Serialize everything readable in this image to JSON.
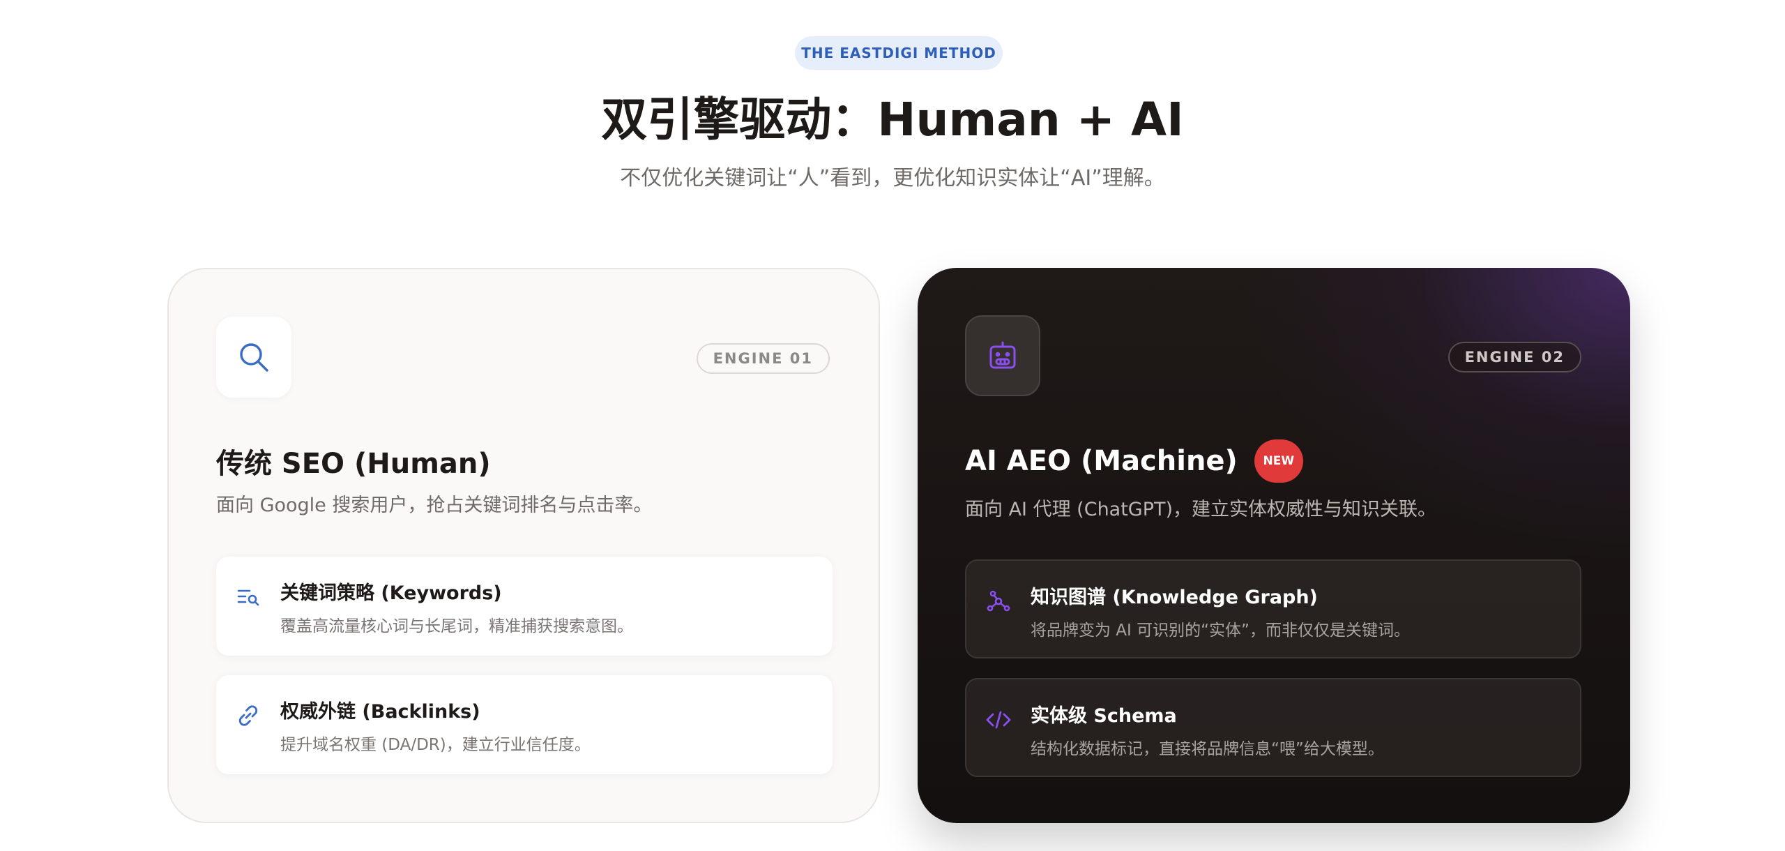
{
  "header": {
    "eyebrow": "THE EASTDIGI METHOD",
    "title": "双引擎驱动：Human + AI",
    "subtitle": "不仅优化关键词让“人”看到，更优化知识实体让“AI”理解。"
  },
  "engine_human": {
    "icon": "search-icon",
    "engine_label": "ENGINE 01",
    "title": "传统 SEO (Human)",
    "description": "面向 Google 搜索用户，抢占关键词排名与点击率。",
    "features": [
      {
        "icon": "keyword-search-icon",
        "title": "关键词策略 (Keywords)",
        "description": "覆盖高流量核心词与长尾词，精准捕获搜索意图。"
      },
      {
        "icon": "link-icon",
        "title": "权威外链 (Backlinks)",
        "description": "提升域名权重 (DA/DR)，建立行业信任度。"
      }
    ]
  },
  "engine_ai": {
    "icon": "robot-icon",
    "engine_label": "ENGINE 02",
    "title": "AI AEO (Machine)",
    "badge": "NEW",
    "description": "面向 AI 代理 (ChatGPT)，建立实体权威性与知识关联。",
    "features": [
      {
        "icon": "graph-nodes-icon",
        "title": "知识图谱 (Knowledge Graph)",
        "description": "将品牌变为 AI 可识别的“实体”，而非仅仅是关键词。"
      },
      {
        "icon": "code-icon",
        "title": "实体级 Schema",
        "description": "结构化数据标记，直接将品牌信息“喂”给大模型。"
      }
    ]
  },
  "colors": {
    "accent_blue": "#2e5fb8",
    "accent_purple": "#7b3fe0",
    "badge_red": "#e03a3a",
    "dark_card": "#1a1412"
  }
}
